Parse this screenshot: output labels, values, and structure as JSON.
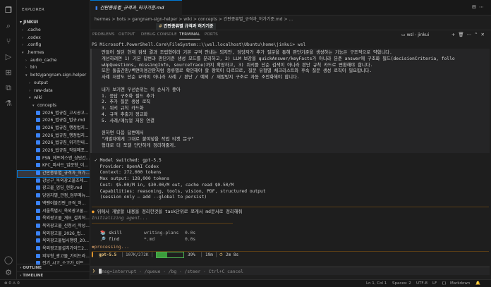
{
  "activity_icons": [
    "files-icon",
    "search-icon",
    "source-control-icon",
    "run-debug-icon",
    "extensions-icon",
    "remote-icon",
    "testing-icon",
    "account-icon",
    "settings-icon"
  ],
  "sidebar": {
    "title": "EXPLORER",
    "root": "JINKUI",
    "items": [
      {
        "label": ".cache",
        "indent": 1,
        "type": "folder",
        "open": false
      },
      {
        "label": ".codex",
        "indent": 1,
        "type": "folder",
        "open": false
      },
      {
        "label": ".config",
        "indent": 1,
        "type": "folder",
        "open": false
      },
      {
        "label": ".hermes",
        "indent": 1,
        "type": "folder",
        "open": true
      },
      {
        "label": "audio_cache",
        "indent": 2,
        "type": "folder",
        "open": false
      },
      {
        "label": "bin",
        "indent": 2,
        "type": "folder",
        "open": false
      },
      {
        "label": "bots\\gangnam-sign-helper",
        "indent": 2,
        "type": "folder",
        "open": true
      },
      {
        "label": "output",
        "indent": 3,
        "type": "folder",
        "open": false
      },
      {
        "label": "raw-data",
        "indent": 3,
        "type": "folder",
        "open": false
      },
      {
        "label": "wiki",
        "indent": 3,
        "type": "folder",
        "open": true
      },
      {
        "label": "concepts",
        "indent": 4,
        "type": "folder",
        "open": true
      },
      {
        "label": "2026_법규집_고시공고...",
        "indent": 5,
        "type": "file"
      },
      {
        "label": "2026_법규집_법규.md",
        "indent": 5,
        "type": "file"
      },
      {
        "label": "2026_법규집_행정법지...",
        "indent": 5,
        "type": "file"
      },
      {
        "label": "2026_법규집_행정법지...",
        "indent": 5,
        "type": "file"
      },
      {
        "label": "2026_법규집_위기안내...",
        "indent": 5,
        "type": "file"
      },
      {
        "label": "2026_법규집_작업매포...",
        "indent": 5,
        "type": "file"
      },
      {
        "label": "FSN_헤프에스엔_상단간...",
        "indent": 5,
        "type": "file"
      },
      {
        "label": "KFC_파사드_업문형_이...",
        "indent": 5,
        "type": "file"
      },
      {
        "label": "간판종류별_규격과_허가...",
        "indent": 5,
        "type": "file",
        "active": true
      },
      {
        "label": "강남구_옥외광고물조례...",
        "indent": 5,
        "type": "file"
      },
      {
        "label": "광고물_업딩_현황.md",
        "indent": 5,
        "type": "file"
      },
      {
        "label": "당업자별_관점_업무매뉴...",
        "indent": 5,
        "type": "file"
      },
      {
        "label": "백팬이블간판_규격_허...",
        "indent": 5,
        "type": "file"
      },
      {
        "label": "서울특별시_옥외광고물...",
        "indent": 5,
        "type": "file"
      },
      {
        "label": "옥외광고물_개요_설치허...",
        "indent": 5,
        "type": "file"
      },
      {
        "label": "옥외광고물_신청서_작성...",
        "indent": 5,
        "type": "file"
      },
      {
        "label": "옥외광고물_2026_법...",
        "indent": 5,
        "type": "file"
      },
      {
        "label": "옥외광고물법시행령_20...",
        "indent": 5,
        "type": "file"
      },
      {
        "label": "옥외광고물설치가이드2...",
        "indent": 5,
        "type": "file"
      },
      {
        "label": "외부형_광고물_가이드라...",
        "indent": 5,
        "type": "file"
      },
      {
        "label": "전기_시고_소고가_이트",
        "indent": 5,
        "type": "file"
      }
    ],
    "outline": "OUTLINE",
    "timeline": "TIMELINE"
  },
  "editor": {
    "tab_label": "간판종류별_규격과_허가기준.md",
    "breadcrumb": "hermes > bots > gangnam-sign-helper > wiki > concepts > 간판종류별_규격과_허가기준.md > ...",
    "doc_title": "간판종류별 규격과 허가기준"
  },
  "panel": {
    "tabs": [
      "PROBLEMS",
      "OUTPUT",
      "DEBUG CONSOLE",
      "TERMINAL",
      "PORTS"
    ],
    "active_tab": "TERMINAL",
    "terminal_name": "wsl - jinkui"
  },
  "terminal": {
    "prompt": "PS Microsoft.PowerShell.Core\\FileSystem::\\\\wsl.localhost\\Ubuntu\\home\\jinkui> wsl",
    "message_lines": [
      "만들어 뒀던 현재 검색 결과 조립형이라 기본 규격 안내는 되지만, 담당자가 추가 질문을 통해 판단기준을 생성하는 기능은 구조적으로 약합니다.",
      "개선하려면 1) 기본 답변과 판단기준 생성 모드를 분리하고, 2) LLM 보강을 quickAnswer/keyFacts가 아니라 분준 answer에 구조화 필드(decisionCriteria, follo",
      "wUpQuestions, missingInfo, sourceTrace)까지 확장하고, 3) 위키를 단순 검색이 아니라 판단 규칙 카드로 변환해야 합니다.",
      "또한 돌출간판/벽면이용간판처럼 종류별로 확인해야 할 항목이 다르므로, 질문 유형별 체크리스트와 후속 질문 생성 로직이 필요합니다.",
      "사례 저장도 단순 요약이 아니라 사례 / 판단 / 예외 / 재발방지 구조로 자동 조안화해야 합니다.",
      "",
      "내가 보기엔 우선순위는 이 순서가 좋아",
      "1. 응답 구조화 필드 추가",
      "2. 추가 질문 생성 로직",
      "3. 위키 규칙 카드화",
      "4. 규격 추출기 정교화",
      "5. 사례/매뉴얼 저장 연결",
      "",
      "원하면 다음 답변에서",
      "\"개발자에게 그대로 붙여넣을 작업 티켓 문구\"",
      "형태로 더 쪼갤 단단하게 정리해줄게."
    ],
    "model_lines": [
      "✓ Model switched: gpt-5.5",
      "  Provider: OpenAI Codex",
      "  Context: 272,000 tokens",
      "  Max output: 128,000 tokens",
      "  Cost: $5.00/M in, $30.00/M out, cache read $0.50/M",
      "  Capabilities: reasoning, tools, vision, PDF, structured output",
      "  (session only — add --global to persist)"
    ],
    "task_line": "위에서 개발할 내용을 정리한것을 task단위로 쪼개서 md문서로 정리해줘",
    "init_line": "Initializing agent...",
    "tool_rows": [
      {
        "icon": "📚",
        "name": "skill",
        "arg": "writing-plans",
        "time": "0.0s"
      },
      {
        "icon": "🔎",
        "name": "find",
        "arg": "*.md",
        "time": "0.0s"
      }
    ],
    "processing": "processing...",
    "status": {
      "model": "gpt-5.5",
      "tokens": "107K/272K",
      "percent": "39%",
      "progress": 0.39,
      "elapsed": "19m",
      "duration": "2m 8s"
    },
    "input_hint": "msg=interrupt · /queue · /bg · /steer · Ctrl+C cancel",
    "input_prompt": "❯"
  },
  "statusbar": {
    "left": "⊗ 0  ⚠ 0",
    "position": "Ln 1, Col 1",
    "spaces": "Spaces: 2",
    "encoding": "UTF-8",
    "eol": "LF",
    "language": "Markdown"
  },
  "colors": {
    "accent": "#0078d4",
    "terminal_bg": "#1e1e1e",
    "orange": "#f0a030",
    "green": "#3c9c3c"
  }
}
